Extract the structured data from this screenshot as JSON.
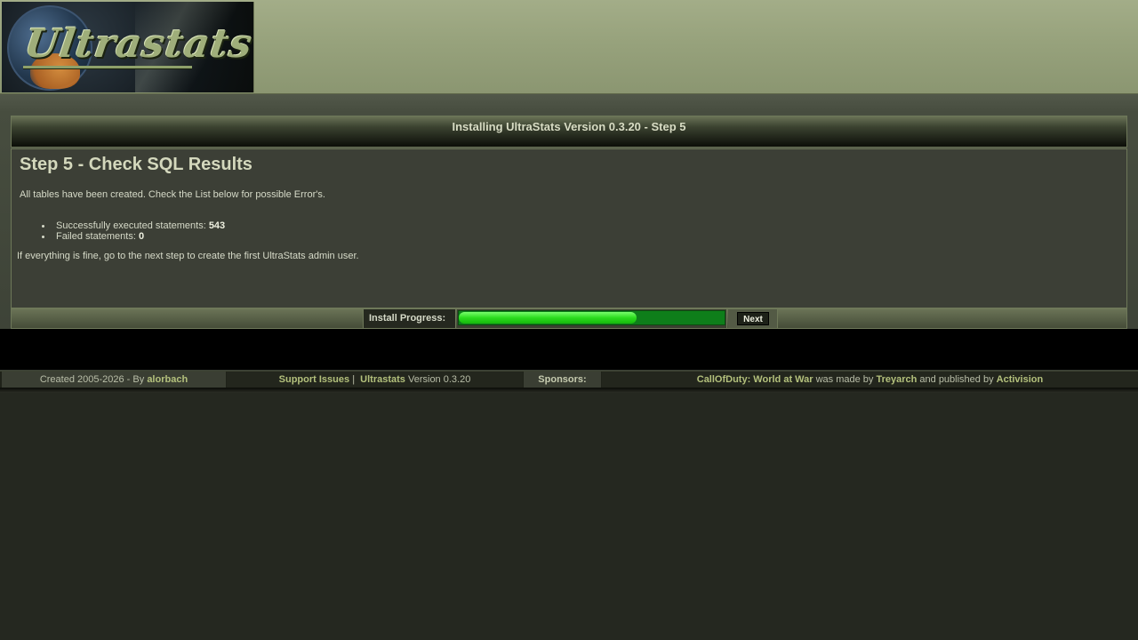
{
  "header": {
    "logo_text": "Ultrastats"
  },
  "main": {
    "title": "Installing UltraStats Version 0.3.20 - Step 5",
    "heading": "Step 5 - Check SQL Results",
    "intro": "All tables have been created. Check the List below for possible Error's.",
    "results": [
      {
        "label": "Successfully executed statements:",
        "value": "543"
      },
      {
        "label": "Failed statements:",
        "value": "0"
      }
    ],
    "outro": "If everything is fine, go to the next step to create the first UltraStats admin user."
  },
  "progress": {
    "label": "Install Progress:",
    "fraction": 0.67,
    "next_label": "Next"
  },
  "footer": {
    "created_text": "Created 2005-2026 - By",
    "author": "alorbach",
    "support_link": "Support Issues",
    "separator": "|",
    "app_link": "Ultrastats",
    "version_text": "Version 0.3.20",
    "sponsors_label": "Sponsors:",
    "game_link": "CallOfDuty: World at War",
    "made_by_text": "was made by",
    "developer_link": "Treyarch",
    "published_text": "and published by",
    "publisher_link": "Activision"
  },
  "colors": {
    "progress_fill": "#2bdc1e",
    "link": "#b3c07c"
  }
}
